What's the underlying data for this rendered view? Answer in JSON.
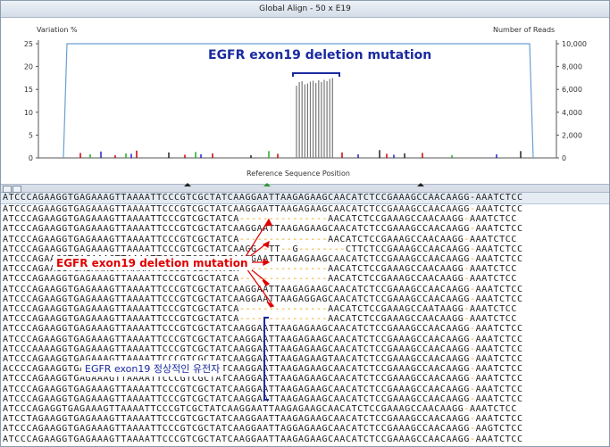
{
  "window": {
    "title": "Global Align - 50 x E19"
  },
  "chart": {
    "left_axis_label": "Variation %",
    "right_axis_label": "Number of Reads",
    "x_axis_label": "Reference Sequence Position",
    "left_ticks": [
      "25",
      "20",
      "15",
      "10",
      "5",
      "0"
    ],
    "right_ticks": [
      "10,000",
      "8,000",
      "6,000",
      "4,000",
      "2,000",
      "0"
    ],
    "annotation": "EGFR exon19 deletion mutation"
  },
  "chart_data": {
    "type": "bar",
    "ylim": [
      0,
      25
    ],
    "y2lim": [
      0,
      10000
    ],
    "reads_plateau": 10000,
    "cluster_values": [
      15.8,
      16.6,
      16.8,
      16.1,
      16.3,
      16.7,
      16.9,
      16.4,
      17.0,
      16.6,
      17.1,
      16.8,
      17.3,
      17.5
    ]
  },
  "sequences": {
    "reference": "ATCCCAGAAGGTGAGAAAGTTAAAATTCCCGTCGCTATCAAGGAATTAAGAGAAGCAACATCTCCGAAAGCCAACAAGG-AAATCTCC",
    "rows": [
      "ATCCCAGAAGGTGAGAAAGTTAAAATTCCCGTCGCTATCAAGGAATTAAGAGAAGCAACATCTCCGAAAGCCAACAAGG-AAATCTCC",
      "ATCCCAGAAGGTGAGAAAGTTAAAATTCCCGTCGCTATCA---------------AACATCTCCGAAAGCCAACAAGG-AAATCTCC",
      "ATCCCAGAAGGTGAGAAAGTTAAAATTCCCGTCGCTATCAAGGAATTAAGAGAAGCAACATCTCCGAAAGCCAACAAGG-AAATCTCC",
      "ATCCCAGAAGGTGAGAAAGTTAAAATTCCCGTCGCTATCA---------------AACATCTCCGAAAGCCAACAAGG-AAATCTCC",
      "ATCCCAGAAGGTGAGAAAGTTAAAATTCCCGTCGCTATCAAGG--TT--G--------CTTCTCCGAAAGCCAACAAGG-AAATCTCC",
      "ATCCCAGAAGGTGAGAAAGTTAAAATTCCCGTCGCTATCAAGGAATTAAGAGAAGCAACATCTCCGAAAGCCAACAAGG-AAATCTCC",
      "ATCCCAGAAGGTGAGAAAGTTAAAATTCCCGTCGCTATCA---------------AACATCTCCGAAAGCCAACAAGG-AAATCTCC",
      "ATCCCAGAAGGTGAGAAAGTTAAAATTCCCGTCGCTATCA---------------AACATCTCCGAAAGCCAACAAGG-AAATCTCC",
      "ATCCCAGAAGGTGAGAAAGTTAAAATTCCCGTCGCTATCAAGGAATTAAGAGAAGCAACATCTCCGAAAGCCAACAAGG-AAATCTCC",
      "ATCCCAGAAGGTGAGAAAGTTAAAATTCCCGTCGCTATCAAGGAATTAAGAGGAGCAACATCTCCGAAAGCCAACAAGG-AAATCTCC",
      "ATCCCAGAAGGTGAGAAAGTTAAAATTCCCGTCGCTATCA---------------AACATCTCCGAAAGCCAATAAGG-AAATCTCC",
      "ATCCCAGAAGGTGAGAAAGTTAAAATTCCCGTCGCTATCA---------------AACATCTCCGAAAGCCAACAAGG-AAATCTCC",
      "ATCCCAGAAGGTGAGAAAGTTAAAATTCCCGTCGCTATCAAGGAATTAAGAGAAGCAACATCTCCGAAAGCCAACAAGG-AAATCTCC",
      "ATCCCAGAAGGTGAGAAAGTTAAAATTCCCGTCGCTATCAAGGAATTAAGAGAAGCAACATCTCCGAAAGCCAACAAGG-AAATCTCC",
      "ATCCCAAAAGGTGAGAAAGTTAAAATTCCCGTCGCTATCAAGGAATTAAGAGAAGCAACATCTCCGAAAGCCAACAAGG-AAATCTCC",
      "ATCCCAGAAGGTGAGAAAGTTAAAATTCCCGTCGCTATCAAGGAATTAAGAGAAGTAACATCTCCGAAAGCCAACAAGG-AAATCTCC",
      "ACCCCAGAAGGTGAGAAAGTTAAAATTCCCGTCGCTATCAAGGAATTAAGAGAAGCAACATCTCCGAAAGCCAACAAGG-AAATCTCC",
      "ATCCCAGAAGGTGAGAAAGTTAAAATTCCCGTCGCTATCAAGGAATTAAGAGAAGCAACATCTCCGAAAGCCAACAAGG-AAATCTCC",
      "ATCCCAGAAGGTGAGAAAGTTAAAATTCCCGTCGCTATCAAGGAATTAAGAGAAGCAACATCTCCGAAAGCCAACAAGG-AAATCTCC",
      "ATCCCAGAAGGTGAGAAAGTTAAAATTCCCGTCGCTATCAAGGAATTAAGAGAAGCAACATCTCCGAAAGCCAACAAGG-AAATCTCC",
      "ATCCCAGAGGTGAGAAAGTTAAAATTCCCGTCGCTATCAAGGAATTAAGAGAAGCAACATCTCCGAAAGCCAACAAGG-AAATCTCC",
      "ATCCTAGAAGGTGAGAAAGTTAAAATTCCCGTCGCTATCAAGGAATTAAGAGAAGCAACATCTCCGAAAGCCAACAAGG-AAATCTCC",
      "ATCCCAGAAGGTGAGAAAGTTAAAATTCCCGTCGCTATCAAGGAATTAGGAGAAGCAACATCTCCGAAAGCCAACAAGG-AAGTCTCC",
      "ATCCCAGAAGGTGAGAAAGTTAAAATTCCCGTCGCTATCAAGGAATTAAGAGAAGCAACATCTCCGAAAGCCAACAAGG-AAATCTCC"
    ]
  },
  "annotations": {
    "deletion_label": "EGFR exon19 deletion mutation",
    "normal_label": "EGFR exon19 정상적인 유전자"
  }
}
